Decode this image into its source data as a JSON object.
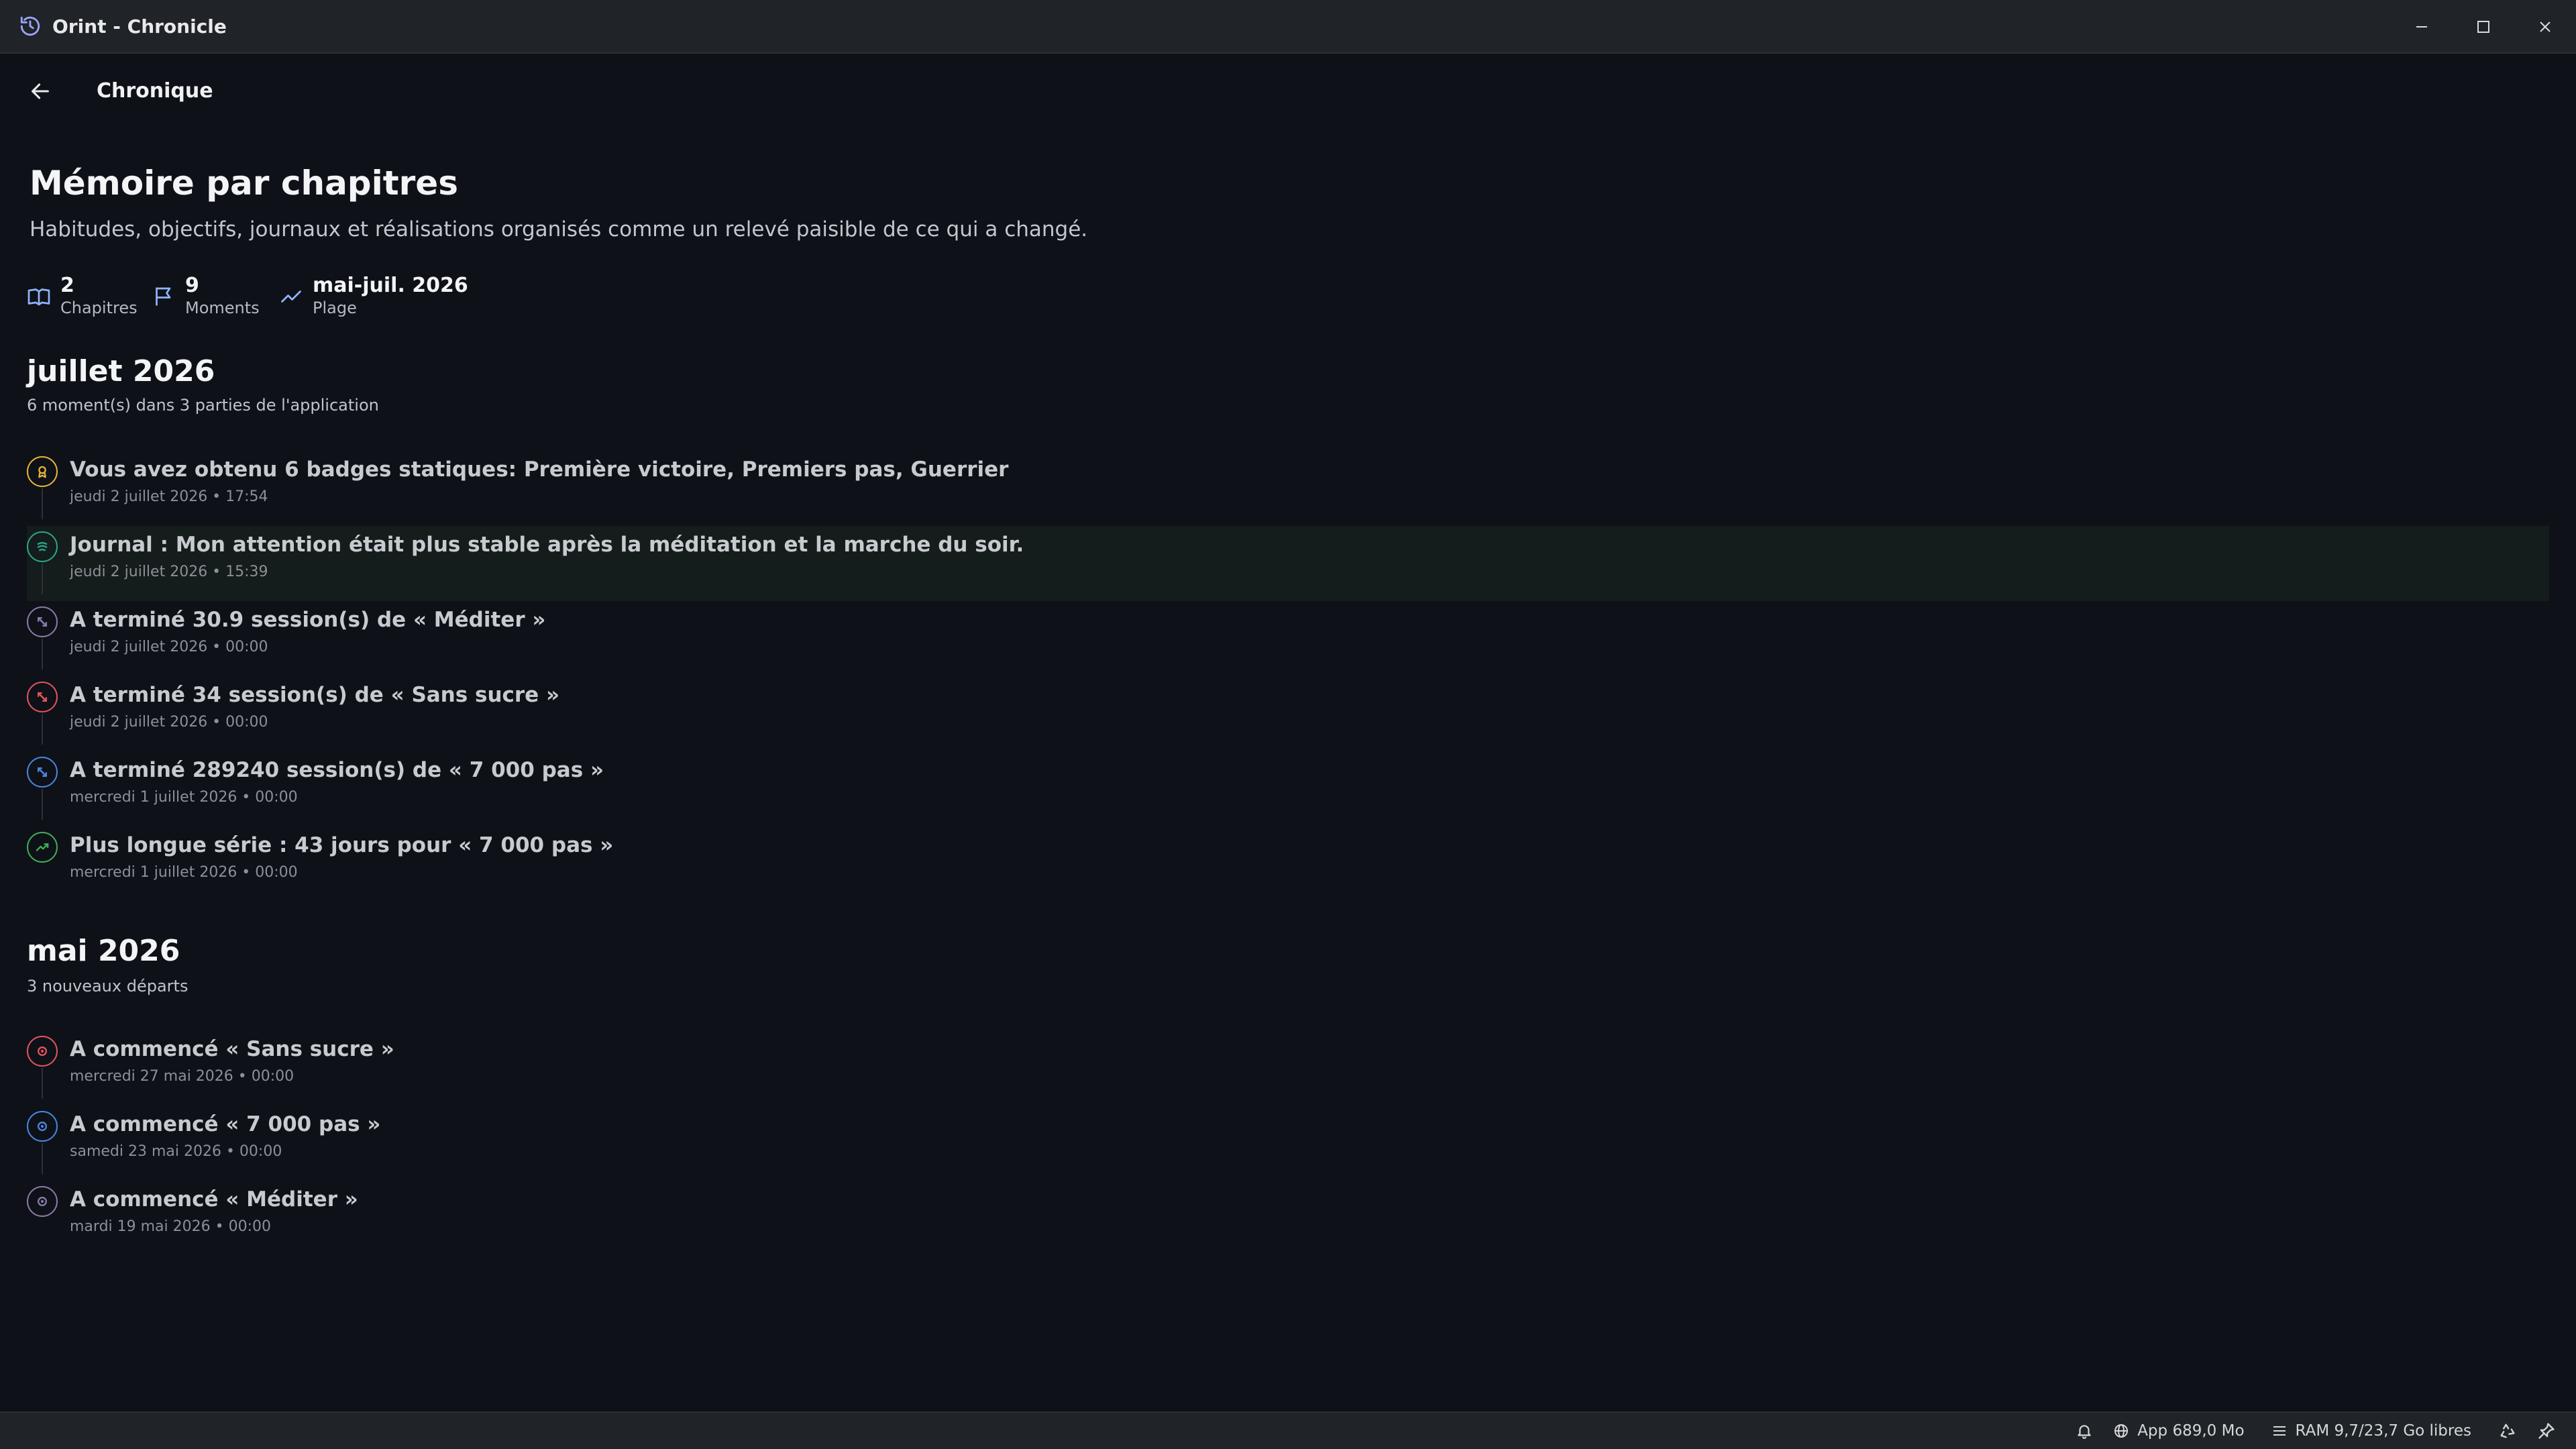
{
  "window": {
    "title": "Orint - Chronicle",
    "icons": {
      "app": "history-icon",
      "minimize": "minimize-icon",
      "maximize": "maximize-icon",
      "close": "close-icon"
    }
  },
  "nav": {
    "title": "Chronique",
    "back_icon": "arrow-left-icon"
  },
  "page": {
    "title": "Mémoire par chapitres",
    "subtitle": "Habitudes, objectifs, journaux et réalisations organisés comme un relevé paisible de ce qui a changé."
  },
  "stats": {
    "chapters": {
      "value": "2",
      "label": "Chapitres",
      "icon": "book-open-icon"
    },
    "moments": {
      "value": "9",
      "label": "Moments",
      "icon": "flag-icon"
    },
    "range": {
      "value": "mai-juil. 2026",
      "label": "Plage",
      "icon": "trend-line-icon"
    }
  },
  "colors": {
    "background": "#0e1117",
    "titlebar": "#202327",
    "yellow": "#e8b23a",
    "teal": "#2aa58a",
    "purple": "#8a7aa8",
    "red": "#e0545c",
    "blue": "#4a86e0",
    "green": "#3fae5a"
  },
  "months": [
    {
      "title": "juillet 2026",
      "subtitle": "6 moment(s) dans 3 parties de l'application",
      "events": [
        {
          "title": "Vous avez obtenu 6 badges statiques: Première victoire, Premiers pas, Guerrier",
          "time": "jeudi 2 juillet 2026 • 17:54",
          "icon": "badge-icon",
          "color": "#e8b23a",
          "highlight": false
        },
        {
          "title": "Journal : Mon attention était plus stable après la méditation et la marche du soir.",
          "time": "jeudi 2 juillet 2026 • 15:39",
          "icon": "journal-icon",
          "color": "#2aa58a",
          "highlight": true
        },
        {
          "title": "A terminé 30.9 session(s) de « Méditer »",
          "time": "jeudi 2 juillet 2026 • 00:00",
          "icon": "session-icon",
          "color": "#8a7aa8",
          "highlight": false
        },
        {
          "title": "A terminé 34 session(s) de « Sans sucre »",
          "time": "jeudi 2 juillet 2026 • 00:00",
          "icon": "session-icon",
          "color": "#e0545c",
          "highlight": false
        },
        {
          "title": "A terminé 289240 session(s) de « 7 000 pas »",
          "time": "mercredi 1 juillet 2026 • 00:00",
          "icon": "session-icon",
          "color": "#4a86e0",
          "highlight": false
        },
        {
          "title": "Plus longue série : 43 jours pour « 7 000 pas »",
          "time": "mercredi 1 juillet 2026 • 00:00",
          "icon": "streak-icon",
          "color": "#3fae5a",
          "highlight": false
        }
      ]
    },
    {
      "title": "mai 2026",
      "subtitle": "3 nouveaux départs",
      "events": [
        {
          "title": "A commencé « Sans sucre »",
          "time": "mercredi 27 mai 2026 • 00:00",
          "icon": "start-icon",
          "color": "#e0545c",
          "highlight": false
        },
        {
          "title": "A commencé « 7 000 pas »",
          "time": "samedi 23 mai 2026 • 00:00",
          "icon": "start-icon",
          "color": "#4a86e0",
          "highlight": false
        },
        {
          "title": "A commencé « Méditer »",
          "time": "mardi 19 mai 2026 • 00:00",
          "icon": "start-icon",
          "color": "#8a7aa8",
          "highlight": false
        }
      ]
    }
  ],
  "statusbar": {
    "app_memory": "App 689,0 Mo",
    "ram": "RAM 9,7/23,7 Go libres",
    "icons": {
      "notifications": "bell-icon",
      "app": "globe-icon",
      "ram": "memory-icon",
      "recycle": "recycle-icon",
      "pin": "pin-icon"
    }
  }
}
